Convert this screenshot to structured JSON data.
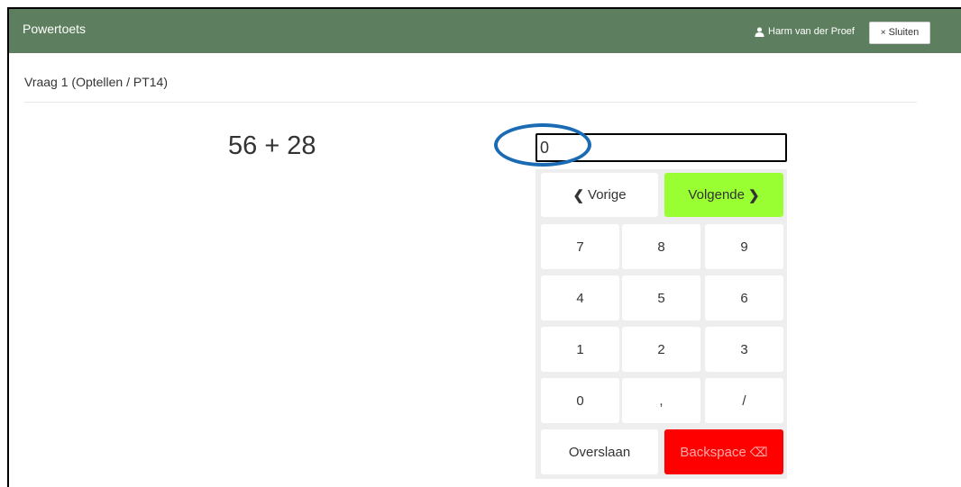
{
  "app": {
    "title": "Powertoets",
    "user_name": "Harm van der Proef",
    "close_label": "Sluiten",
    "header_color": "#5e7f5f"
  },
  "question": {
    "label": "Vraag  1  (Optellen / PT14)",
    "problem": "56 + 28"
  },
  "answer": {
    "value": "0"
  },
  "keypad": {
    "prev_label": "Vorige",
    "next_label": "Volgende",
    "keys": [
      "7",
      "8",
      "9",
      "4",
      "5",
      "6",
      "1",
      "2",
      "3",
      "0",
      ",",
      "/"
    ],
    "skip_label": "Overslaan",
    "backspace_label": "Backspace",
    "next_color": "#99ff33",
    "backspace_color": "#ff0000"
  },
  "annotation": {
    "color": "#1a6bb3"
  }
}
